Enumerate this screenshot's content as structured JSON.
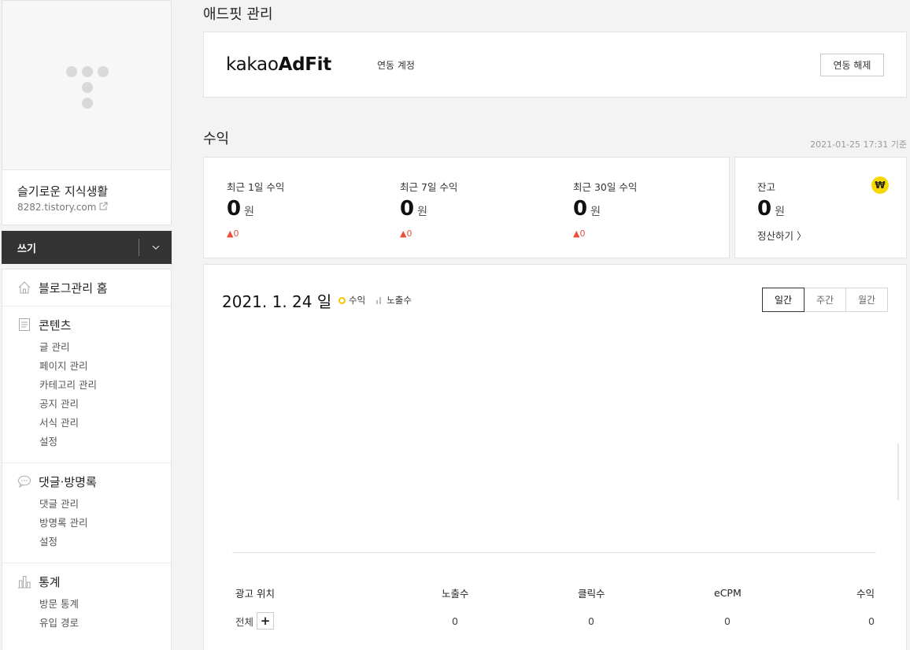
{
  "sidebar": {
    "blog_name": "슬기로운 지식생활",
    "blog_url": "8282.tistory.com",
    "write_label": "쓰기",
    "menu": [
      {
        "icon": "home-icon",
        "label": "블로그관리 홈",
        "items": []
      },
      {
        "icon": "document-icon",
        "label": "콘텐츠",
        "items": [
          "글 관리",
          "페이지 관리",
          "카테고리 관리",
          "공지 관리",
          "서식 관리",
          "설정"
        ]
      },
      {
        "icon": "speech-bubble-icon",
        "label": "댓글·방명록",
        "items": [
          "댓글 관리",
          "방명록 관리",
          "설정"
        ]
      },
      {
        "icon": "bar-chart-icon",
        "label": "통계",
        "items": [
          "방문 통계",
          "유입 경로"
        ]
      }
    ]
  },
  "adfit": {
    "section_title": "애드핏 관리",
    "logo_light": "kakao",
    "logo_bold": "AdFit",
    "linked_label": "연동 계정",
    "unlink_label": "연동 해제"
  },
  "revenue": {
    "section_title": "수익",
    "as_of": "2021-01-25 17:31 기준",
    "cards": [
      {
        "label": "최근 1일 수익",
        "value": "0",
        "unit": "원",
        "delta": "▲0"
      },
      {
        "label": "최근 7일 수익",
        "value": "0",
        "unit": "원",
        "delta": "▲0"
      },
      {
        "label": "최근 30일 수익",
        "value": "0",
        "unit": "원",
        "delta": "▲0"
      }
    ],
    "balance": {
      "label": "잔고",
      "value": "0",
      "unit": "원",
      "link": "정산하기 〉",
      "won_symbol": "₩"
    }
  },
  "chart": {
    "date_label": "2021. 1. 24 일",
    "legend": {
      "revenue": "수익",
      "impressions": "노출수"
    },
    "tabs": [
      "일간",
      "주간",
      "월간"
    ],
    "active_tab": "일간",
    "colors": {
      "revenue": "#f5c400",
      "impressions": "#bbbbbb"
    }
  },
  "table": {
    "headers": [
      "광고 위치",
      "노출수",
      "클릭수",
      "eCPM",
      "수익"
    ],
    "rows": [
      {
        "position": "전체",
        "impressions": "0",
        "clicks": "0",
        "ecpm": "0",
        "revenue": "0"
      }
    ],
    "expand_symbol": "+"
  }
}
